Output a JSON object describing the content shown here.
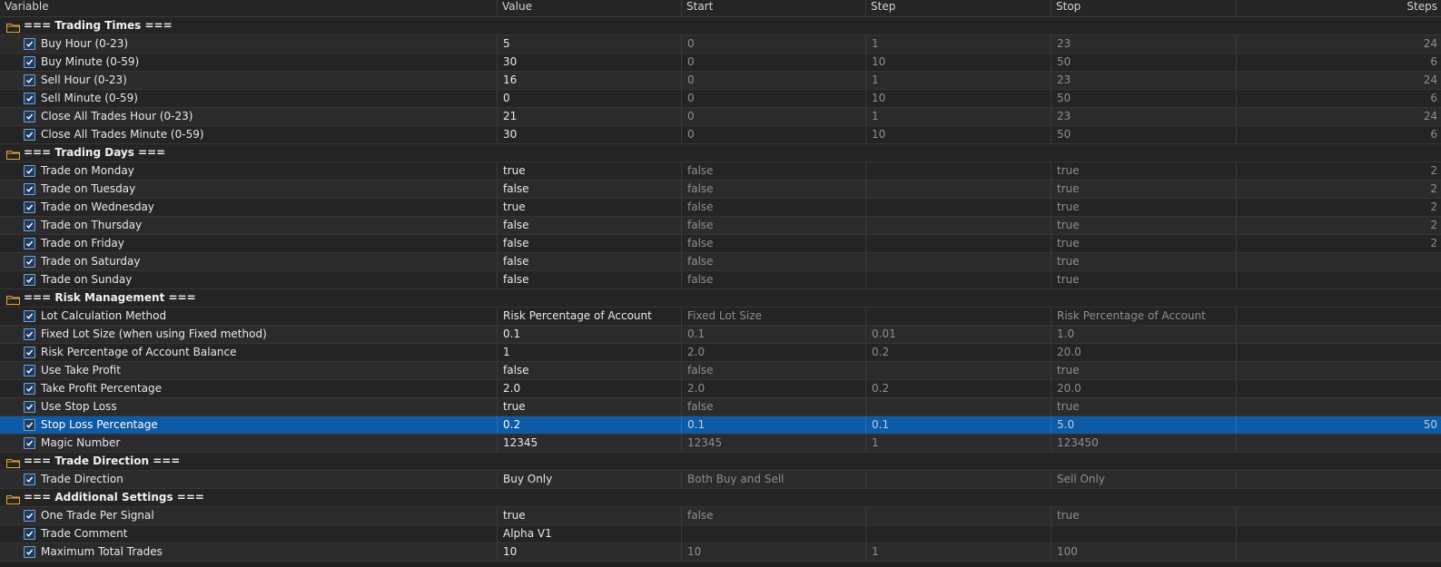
{
  "columns": {
    "variable": "Variable",
    "value": "Value",
    "start": "Start",
    "step": "Step",
    "stop": "Stop",
    "steps": "Steps"
  },
  "groups": [
    {
      "title": "=== Trading Times ===",
      "rows": [
        {
          "name": "Buy Hour (0-23)",
          "value": "5",
          "start": "0",
          "step": "1",
          "stop": "23",
          "steps": "24"
        },
        {
          "name": "Buy Minute (0-59)",
          "value": "30",
          "start": "0",
          "step": "10",
          "stop": "50",
          "steps": "6"
        },
        {
          "name": "Sell Hour (0-23)",
          "value": "16",
          "start": "0",
          "step": "1",
          "stop": "23",
          "steps": "24"
        },
        {
          "name": "Sell Minute (0-59)",
          "value": "0",
          "start": "0",
          "step": "10",
          "stop": "50",
          "steps": "6"
        },
        {
          "name": "Close All Trades Hour (0-23)",
          "value": "21",
          "start": "0",
          "step": "1",
          "stop": "23",
          "steps": "24"
        },
        {
          "name": "Close All Trades Minute (0-59)",
          "value": "30",
          "start": "0",
          "step": "10",
          "stop": "50",
          "steps": "6"
        }
      ]
    },
    {
      "title": "=== Trading Days ===",
      "rows": [
        {
          "name": "Trade on Monday",
          "value": "true",
          "start": "false",
          "step": "",
          "stop": "true",
          "steps": "2"
        },
        {
          "name": "Trade on Tuesday",
          "value": "false",
          "start": "false",
          "step": "",
          "stop": "true",
          "steps": "2"
        },
        {
          "name": "Trade on Wednesday",
          "value": "true",
          "start": "false",
          "step": "",
          "stop": "true",
          "steps": "2"
        },
        {
          "name": "Trade on Thursday",
          "value": "false",
          "start": "false",
          "step": "",
          "stop": "true",
          "steps": "2"
        },
        {
          "name": "Trade on Friday",
          "value": "false",
          "start": "false",
          "step": "",
          "stop": "true",
          "steps": "2"
        },
        {
          "name": "Trade on Saturday",
          "value": "false",
          "start": "false",
          "step": "",
          "stop": "true",
          "steps": ""
        },
        {
          "name": "Trade on Sunday",
          "value": "false",
          "start": "false",
          "step": "",
          "stop": "true",
          "steps": ""
        }
      ]
    },
    {
      "title": "=== Risk Management ===",
      "rows": [
        {
          "name": "Lot Calculation Method",
          "value": "Risk Percentage of Account",
          "start": "Fixed Lot Size",
          "step": "",
          "stop": "Risk Percentage of Account",
          "steps": ""
        },
        {
          "name": "Fixed Lot Size (when using Fixed method)",
          "value": "0.1",
          "start": "0.1",
          "step": "0.01",
          "stop": "1.0",
          "steps": ""
        },
        {
          "name": "Risk Percentage of Account Balance",
          "value": "1",
          "start": "2.0",
          "step": "0.2",
          "stop": "20.0",
          "steps": ""
        },
        {
          "name": "Use Take Profit",
          "value": "false",
          "start": "false",
          "step": "",
          "stop": "true",
          "steps": ""
        },
        {
          "name": "Take Profit Percentage",
          "value": "2.0",
          "start": "2.0",
          "step": "0.2",
          "stop": "20.0",
          "steps": ""
        },
        {
          "name": "Use Stop Loss",
          "value": "true",
          "start": "false",
          "step": "",
          "stop": "true",
          "steps": ""
        },
        {
          "name": "Stop Loss Percentage",
          "value": "0.2",
          "start": "0.1",
          "step": "0.1",
          "stop": "5.0",
          "steps": "50",
          "selected": true
        },
        {
          "name": "Magic Number",
          "value": "12345",
          "start": "12345",
          "step": "1",
          "stop": "123450",
          "steps": ""
        }
      ]
    },
    {
      "title": "=== Trade Direction ===",
      "rows": [
        {
          "name": "Trade Direction",
          "value": "Buy Only",
          "start": "Both Buy and Sell",
          "step": "",
          "stop": "Sell Only",
          "steps": ""
        }
      ]
    },
    {
      "title": "=== Additional Settings ===",
      "rows": [
        {
          "name": "One Trade Per Signal",
          "value": "true",
          "start": "false",
          "step": "",
          "stop": "true",
          "steps": ""
        },
        {
          "name": "Trade Comment",
          "value": "Alpha V1",
          "start": "",
          "step": "",
          "stop": "",
          "steps": ""
        },
        {
          "name": "Maximum Total Trades",
          "value": "10",
          "start": "10",
          "step": "1",
          "stop": "100",
          "steps": ""
        }
      ]
    }
  ],
  "icons": {
    "group": "folder-icon",
    "row": "checkbox-checked-icon"
  },
  "colors": {
    "background": "#1e1e1e",
    "selected_row": "#0d5aa7",
    "folder": "#e6a23c",
    "checkbox": "#7aa0cf"
  }
}
